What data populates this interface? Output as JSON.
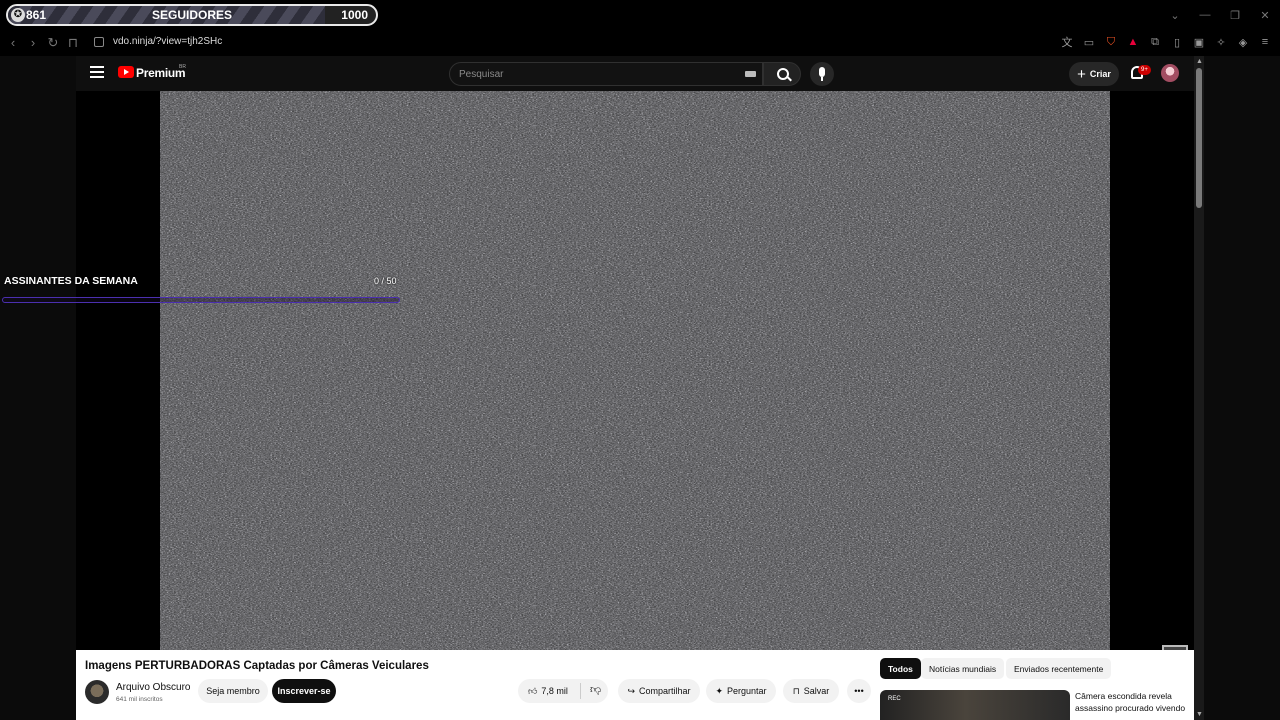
{
  "follower_goal": {
    "current": "861",
    "label": "SEGUIDORES",
    "goal": "1000",
    "progress_fraction": 0.861
  },
  "window_controls": {
    "menu": "⌄",
    "minimize": "—",
    "restore": "❐",
    "close": "✕"
  },
  "browser": {
    "url": "vdo.ninja/?view=tjh2SHc",
    "nav_icons": [
      "back-icon",
      "forward-icon",
      "reload-icon",
      "bookmark-icon"
    ],
    "extension_icons": [
      "translate-icon",
      "cast-icon",
      "brave-shield-icon",
      "bat-rewards-icon",
      "extensions-icon",
      "sidebar-icon",
      "wallet-icon",
      "leo-ai-icon",
      "vpn-icon",
      "menu-icon"
    ]
  },
  "youtube": {
    "brand": "Premium",
    "region": "BR",
    "search_placeholder": "Pesquisar",
    "create_label": "Criar",
    "notifications_badge": "9+",
    "video_title": "Imagens PERTURBADORAS Captadas por Câmeras Veiculares",
    "channel_name": "Arquivo Obscuro",
    "channel_subs": "641 mil inscritos",
    "member_label": "Seja membro",
    "subscribe_label": "Inscrever-se",
    "likes": "7,8 mil",
    "share_label": "Compartilhar",
    "ask_label": "Perguntar",
    "save_label": "Salvar",
    "more_label": "•••",
    "chips": [
      "Todos",
      "Notícias mundiais",
      "Enviados recentemente"
    ],
    "recommendation": {
      "badge": "REC",
      "title": "Câmera escondida revela assassino procurado vivendo"
    }
  },
  "subs_widget": {
    "title": "ASSINANTES DA SEMANA",
    "count": "0 / 50",
    "progress_fraction": 0
  },
  "colors": {
    "yt_red": "#ff0000",
    "widget_purple": "#4b2fb0",
    "brave_orange": "#f25425"
  }
}
